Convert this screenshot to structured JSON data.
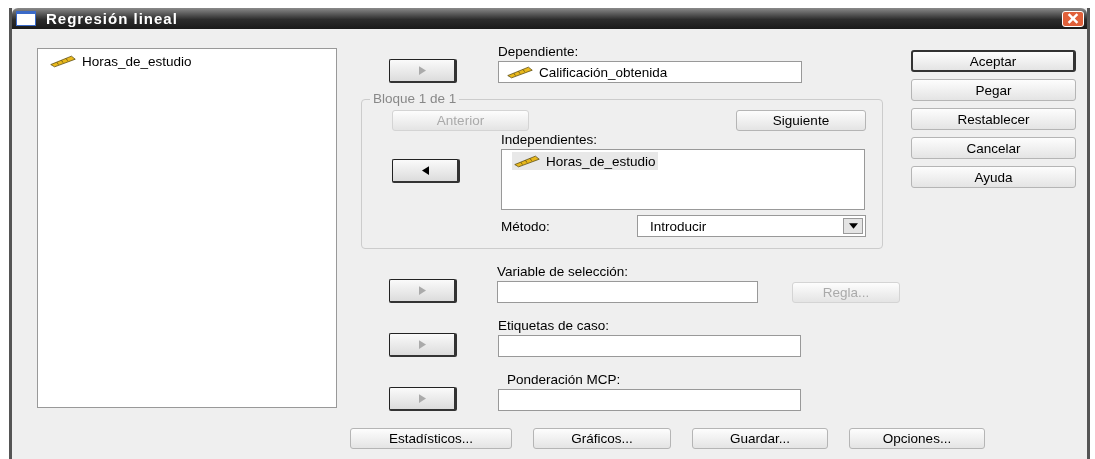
{
  "window": {
    "title": "Regresión lineal"
  },
  "source_list": {
    "items": [
      {
        "label": "Horas_de_estudio",
        "selected": false
      }
    ]
  },
  "dependent": {
    "arrow": {
      "kind": "right",
      "disabled": true
    },
    "label": "Dependiente:",
    "value": "Calificación_obtenida"
  },
  "block": {
    "legend": "Bloque 1 de 1",
    "previous_button": {
      "label": "Anterior",
      "disabled": true
    },
    "next_button": {
      "label": "Siguiente",
      "disabled": false
    },
    "independents": {
      "arrow": {
        "kind": "left",
        "disabled": false
      },
      "label": "Independientes:",
      "items": [
        {
          "label": "Horas_de_estudio",
          "selected": true
        }
      ]
    },
    "method": {
      "label": "Método:",
      "value": "Introducir"
    }
  },
  "selection_variable": {
    "arrow": {
      "kind": "right",
      "disabled": true
    },
    "label": "Variable de selección:",
    "rule_button": {
      "label": "Regla...",
      "disabled": true
    }
  },
  "case_labels": {
    "arrow": {
      "kind": "right",
      "disabled": true
    },
    "label": "Etiquetas de caso:"
  },
  "wls_weight": {
    "arrow": {
      "kind": "right",
      "disabled": true
    },
    "label": "Ponderación MCP:"
  },
  "action_buttons": [
    {
      "label": "Aceptar",
      "default": true
    },
    {
      "label": "Pegar",
      "default": false
    },
    {
      "label": "Restablecer",
      "default": false
    },
    {
      "label": "Cancelar",
      "default": false
    },
    {
      "label": "Ayuda",
      "default": false
    }
  ],
  "bottom_buttons": [
    {
      "label": "Estadísticos..."
    },
    {
      "label": "Gráficos..."
    },
    {
      "label": "Guardar..."
    },
    {
      "label": "Opciones..."
    }
  ]
}
